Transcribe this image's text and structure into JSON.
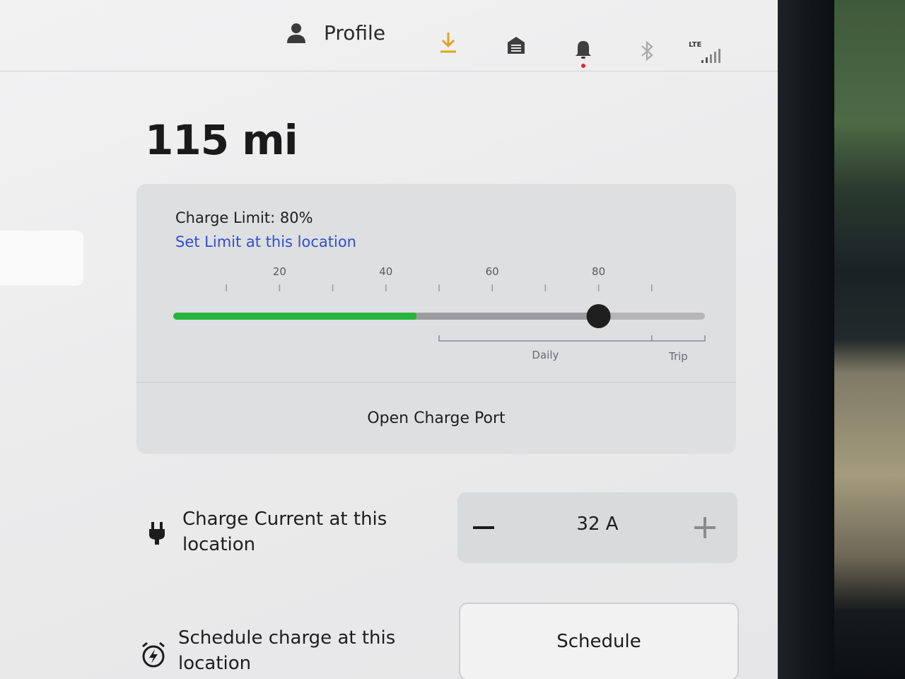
{
  "topbar": {
    "profile_label": "Profile",
    "icons": [
      "person-icon",
      "download-icon",
      "garage-icon",
      "bell-icon",
      "bluetooth-icon",
      "lte-signal-icon"
    ],
    "lte_label": "LTE",
    "accent_download": "#e0a224",
    "alert_dot": "#d92b2b"
  },
  "range": {
    "value": "115 mi"
  },
  "charge": {
    "limit_label": "Charge Limit: 80%",
    "set_limit_link": "Set Limit at this location",
    "limit_percent": 80,
    "current_percent": 46,
    "tick_labels": [
      "20",
      "40",
      "60",
      "80"
    ],
    "daily_label": "Daily",
    "trip_label": "Trip",
    "fill_color": "#26b53a",
    "open_port_label": "Open Charge Port"
  },
  "charge_current": {
    "label": "Charge Current at this location",
    "value": "32  A"
  },
  "schedule": {
    "label": "Schedule charge at this location",
    "button_label": "Schedule"
  }
}
